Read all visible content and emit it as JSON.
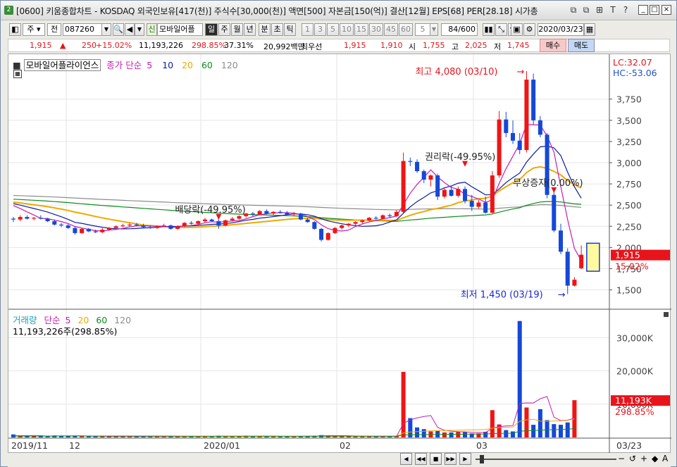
{
  "title": {
    "badge": "2",
    "text": "[0600] 키움종합차트 - KOSDAQ 외국인보유[417(천)] 주식수[30,000(천)] 액면[500] 자본금[150(억)] 결산[12월] EPS[68] PER[28.18] 시가총",
    "buttons": [
      "⧉",
      "⧉",
      "⊞",
      "T",
      "?",
      "_",
      "□",
      "×"
    ]
  },
  "toolbar": {
    "market": "주",
    "prev": "전",
    "code": "087260",
    "new_badge": "신",
    "stock_name": "모바일어플",
    "periods": [
      "일",
      "주",
      "월",
      "년",
      "분",
      "초",
      "틱"
    ],
    "selected_period": "일",
    "intervals": [
      "1",
      "3",
      "5",
      "10",
      "15",
      "30",
      "45",
      "60"
    ],
    "interval_value": "5",
    "count": "84/600",
    "date": "2020/03/23"
  },
  "info": {
    "price": "1,915",
    "change": "250",
    "change_pct": "+15.02%",
    "volume": "11,193,226",
    "volume_pct": "298.85%",
    "turnover": "37.31%",
    "amount": "20,992백만",
    "best_label": "최우선",
    "best_ask": "1,915",
    "best_bid": "1,910",
    "open_label": "시",
    "open": "1,755",
    "high_label": "고",
    "high": "2,025",
    "low_label": "저",
    "low": "1,745",
    "buy": "매수",
    "sell": "매도"
  },
  "price_panel": {
    "stock_label": "모바일어플라이언스",
    "ma_label": "종가 단순",
    "ma_periods": [
      "5",
      "10",
      "20",
      "60",
      "120"
    ],
    "lc": "LC:32.07",
    "hc": "HC:-53.06",
    "current_price": "1,915",
    "current_pct": "15.02%",
    "high_note": "최고 4,080 (03/10)",
    "low_note": "최저 1,450 (03/19)",
    "events": [
      "배당락(-49.95%)",
      "권리락(-49.95%)",
      "무상증자(0.00%)"
    ],
    "y_ticks": [
      "3,750",
      "3,500",
      "3,250",
      "3,000",
      "2,750",
      "2,500",
      "2,250",
      "2,000",
      "1,750",
      "1,500"
    ]
  },
  "volume_panel": {
    "label": "거래량",
    "ma_label": "단순",
    "ma_periods": [
      "5",
      "20",
      "60",
      "120"
    ],
    "value": "11,193,226주(298.85%)",
    "current": "11,193K",
    "current_pct": "298.85%",
    "y_ticks": [
      "30,000K",
      "20,000K",
      "10,000K"
    ]
  },
  "x_axis": {
    "labels": [
      "2019/11",
      "12",
      "2020/01",
      "02",
      "03"
    ],
    "right": "03/23"
  },
  "colors": {
    "up": "#f01414",
    "down": "#1448d8",
    "ma5": "#c81cb4",
    "ma10": "#0a1e9c",
    "ma20": "#f0a800",
    "ma60": "#0c8c1c",
    "ma120": "#8c8c8c"
  },
  "chart_data": {
    "type": "candlestick",
    "candles": [
      {
        "o": 2340,
        "h": 2360,
        "l": 2300,
        "c": 2330
      },
      {
        "o": 2330,
        "h": 2380,
        "l": 2310,
        "c": 2360
      },
      {
        "o": 2360,
        "h": 2380,
        "l": 2330,
        "c": 2340
      },
      {
        "o": 2340,
        "h": 2360,
        "l": 2320,
        "c": 2350
      },
      {
        "o": 2350,
        "h": 2380,
        "l": 2330,
        "c": 2340
      },
      {
        "o": 2340,
        "h": 2350,
        "l": 2300,
        "c": 2310
      },
      {
        "o": 2310,
        "h": 2330,
        "l": 2260,
        "c": 2270
      },
      {
        "o": 2270,
        "h": 2290,
        "l": 2240,
        "c": 2260
      },
      {
        "o": 2260,
        "h": 2280,
        "l": 2220,
        "c": 2230
      },
      {
        "o": 2230,
        "h": 2250,
        "l": 2150,
        "c": 2170
      },
      {
        "o": 2170,
        "h": 2230,
        "l": 2160,
        "c": 2220
      },
      {
        "o": 2220,
        "h": 2230,
        "l": 2180,
        "c": 2190
      },
      {
        "o": 2190,
        "h": 2210,
        "l": 2170,
        "c": 2180
      },
      {
        "o": 2180,
        "h": 2230,
        "l": 2170,
        "c": 2210
      },
      {
        "o": 2210,
        "h": 2240,
        "l": 2200,
        "c": 2230
      },
      {
        "o": 2230,
        "h": 2260,
        "l": 2220,
        "c": 2250
      },
      {
        "o": 2250,
        "h": 2280,
        "l": 2240,
        "c": 2260
      },
      {
        "o": 2260,
        "h": 2290,
        "l": 2240,
        "c": 2270
      },
      {
        "o": 2270,
        "h": 2290,
        "l": 2250,
        "c": 2260
      },
      {
        "o": 2260,
        "h": 2280,
        "l": 2230,
        "c": 2240
      },
      {
        "o": 2240,
        "h": 2260,
        "l": 2220,
        "c": 2230
      },
      {
        "o": 2230,
        "h": 2260,
        "l": 2220,
        "c": 2250
      },
      {
        "o": 2250,
        "h": 2280,
        "l": 2240,
        "c": 2260
      },
      {
        "o": 2260,
        "h": 2270,
        "l": 2210,
        "c": 2220
      },
      {
        "o": 2220,
        "h": 2260,
        "l": 2210,
        "c": 2250
      },
      {
        "o": 2250,
        "h": 2300,
        "l": 2240,
        "c": 2290
      },
      {
        "o": 2290,
        "h": 2310,
        "l": 2270,
        "c": 2280
      },
      {
        "o": 2280,
        "h": 2320,
        "l": 2270,
        "c": 2310
      },
      {
        "o": 2310,
        "h": 2350,
        "l": 2290,
        "c": 2330
      },
      {
        "o": 2330,
        "h": 2340,
        "l": 2300,
        "c": 2310
      },
      {
        "o": 2310,
        "h": 2350,
        "l": 2220,
        "c": 2260
      },
      {
        "o": 2260,
        "h": 2330,
        "l": 2250,
        "c": 2320
      },
      {
        "o": 2320,
        "h": 2360,
        "l": 2310,
        "c": 2340
      },
      {
        "o": 2340,
        "h": 2380,
        "l": 2330,
        "c": 2370
      },
      {
        "o": 2370,
        "h": 2410,
        "l": 2350,
        "c": 2400
      },
      {
        "o": 2400,
        "h": 2420,
        "l": 2370,
        "c": 2390
      },
      {
        "o": 2390,
        "h": 2440,
        "l": 2380,
        "c": 2430
      },
      {
        "o": 2430,
        "h": 2450,
        "l": 2390,
        "c": 2400
      },
      {
        "o": 2400,
        "h": 2430,
        "l": 2380,
        "c": 2420
      },
      {
        "o": 2420,
        "h": 2440,
        "l": 2400,
        "c": 2410
      },
      {
        "o": 2410,
        "h": 2430,
        "l": 2380,
        "c": 2390
      },
      {
        "o": 2390,
        "h": 2420,
        "l": 2370,
        "c": 2400
      },
      {
        "o": 2400,
        "h": 2410,
        "l": 2320,
        "c": 2330
      },
      {
        "o": 2330,
        "h": 2350,
        "l": 2290,
        "c": 2300
      },
      {
        "o": 2300,
        "h": 2310,
        "l": 2210,
        "c": 2220
      },
      {
        "o": 2220,
        "h": 2230,
        "l": 2070,
        "c": 2090
      },
      {
        "o": 2090,
        "h": 2180,
        "l": 2080,
        "c": 2170
      },
      {
        "o": 2170,
        "h": 2240,
        "l": 2160,
        "c": 2230
      },
      {
        "o": 2230,
        "h": 2270,
        "l": 2210,
        "c": 2260
      },
      {
        "o": 2260,
        "h": 2290,
        "l": 2240,
        "c": 2280
      },
      {
        "o": 2280,
        "h": 2310,
        "l": 2260,
        "c": 2300
      },
      {
        "o": 2300,
        "h": 2330,
        "l": 2280,
        "c": 2320
      },
      {
        "o": 2320,
        "h": 2360,
        "l": 2310,
        "c": 2350
      },
      {
        "o": 2350,
        "h": 2370,
        "l": 2330,
        "c": 2340
      },
      {
        "o": 2340,
        "h": 2390,
        "l": 2330,
        "c": 2380
      },
      {
        "o": 2380,
        "h": 2400,
        "l": 2350,
        "c": 2370
      },
      {
        "o": 2370,
        "h": 2440,
        "l": 2360,
        "c": 2420
      },
      {
        "o": 2420,
        "h": 3120,
        "l": 2410,
        "c": 3020
      },
      {
        "o": 3020,
        "h": 3060,
        "l": 2960,
        "c": 3010
      },
      {
        "o": 3010,
        "h": 3040,
        "l": 2880,
        "c": 2900
      },
      {
        "o": 2900,
        "h": 2920,
        "l": 2760,
        "c": 2800
      },
      {
        "o": 2800,
        "h": 2860,
        "l": 2720,
        "c": 2850
      },
      {
        "o": 2850,
        "h": 2870,
        "l": 2560,
        "c": 2600
      },
      {
        "o": 2600,
        "h": 2700,
        "l": 2580,
        "c": 2680
      },
      {
        "o": 2680,
        "h": 2720,
        "l": 2600,
        "c": 2610
      },
      {
        "o": 2610,
        "h": 2720,
        "l": 2590,
        "c": 2690
      },
      {
        "o": 2690,
        "h": 2720,
        "l": 2520,
        "c": 2550
      },
      {
        "o": 2550,
        "h": 2620,
        "l": 2430,
        "c": 2480
      },
      {
        "o": 2480,
        "h": 2560,
        "l": 2460,
        "c": 2530
      },
      {
        "o": 2530,
        "h": 2600,
        "l": 2400,
        "c": 2410
      },
      {
        "o": 2410,
        "h": 2900,
        "l": 2400,
        "c": 2850
      },
      {
        "o": 2850,
        "h": 3610,
        "l": 2820,
        "c": 3510
      },
      {
        "o": 3510,
        "h": 3600,
        "l": 3300,
        "c": 3350
      },
      {
        "o": 3350,
        "h": 3500,
        "l": 3220,
        "c": 3260
      },
      {
        "o": 3260,
        "h": 3350,
        "l": 3100,
        "c": 3150
      },
      {
        "o": 3150,
        "h": 4080,
        "l": 3120,
        "c": 3980
      },
      {
        "o": 3980,
        "h": 4050,
        "l": 3450,
        "c": 3500
      },
      {
        "o": 3500,
        "h": 3550,
        "l": 3300,
        "c": 3330
      },
      {
        "o": 3330,
        "h": 3350,
        "l": 2580,
        "c": 2620
      },
      {
        "o": 2620,
        "h": 2700,
        "l": 2180,
        "c": 2200
      },
      {
        "o": 2200,
        "h": 2280,
        "l": 1920,
        "c": 1950
      },
      {
        "o": 1950,
        "h": 1990,
        "l": 1450,
        "c": 1550
      },
      {
        "o": 1550,
        "h": 1650,
        "l": 1540,
        "c": 1620
      },
      {
        "o": 1755,
        "h": 2025,
        "l": 1745,
        "c": 1915
      }
    ],
    "volume_k": [
      900,
      500,
      400,
      400,
      400,
      300,
      600,
      500,
      400,
      500,
      300,
      300,
      300,
      400,
      300,
      300,
      300,
      300,
      300,
      300,
      300,
      300,
      300,
      300,
      300,
      300,
      300,
      300,
      300,
      300,
      500,
      300,
      300,
      300,
      500,
      300,
      400,
      300,
      300,
      300,
      300,
      300,
      400,
      400,
      500,
      700,
      600,
      500,
      400,
      300,
      300,
      300,
      300,
      300,
      300,
      300,
      400,
      19700,
      5800,
      3000,
      2500,
      1800,
      2000,
      1500,
      1500,
      1800,
      1600,
      1200,
      1200,
      1700,
      8200,
      3900,
      2200,
      1800,
      35000,
      9000,
      3800,
      8500,
      5200,
      4000,
      3800,
      4500,
      11193
    ],
    "ylim": [
      1400,
      4080
    ],
    "volume_ylim": [
      0,
      36000
    ]
  }
}
